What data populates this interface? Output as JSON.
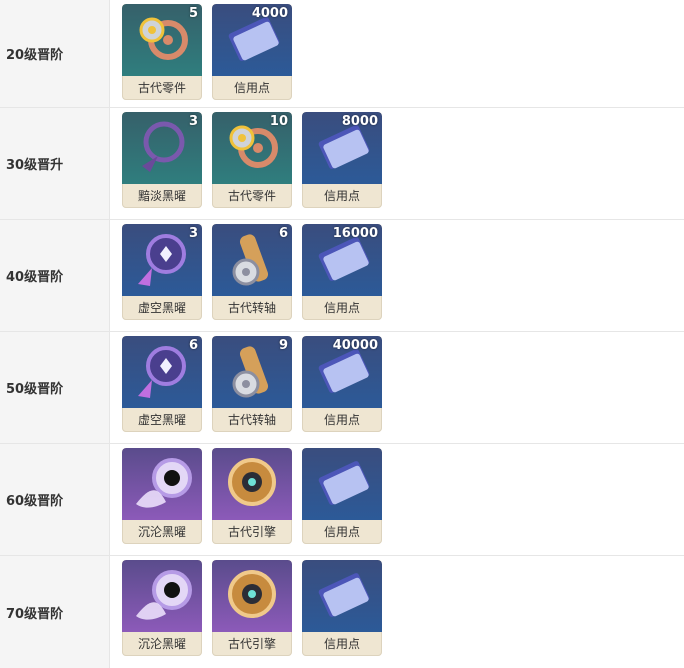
{
  "rows": [
    {
      "label": "20级晋阶",
      "items": [
        {
          "name": "古代零件",
          "count": "5",
          "icon": "ancient-part-icon",
          "bg": "teal"
        },
        {
          "name": "信用点",
          "count": "4000",
          "icon": "credit-icon",
          "bg": "blue"
        }
      ]
    },
    {
      "label": "30级晋升",
      "items": [
        {
          "name": "黯淡黑曜",
          "count": "3",
          "icon": "dim-obsidian-icon",
          "bg": "teal"
        },
        {
          "name": "古代零件",
          "count": "10",
          "icon": "ancient-part-icon",
          "bg": "teal"
        },
        {
          "name": "信用点",
          "count": "8000",
          "icon": "credit-icon",
          "bg": "blue"
        }
      ]
    },
    {
      "label": "40级晋阶",
      "items": [
        {
          "name": "虚空黑曜",
          "count": "3",
          "icon": "void-obsidian-icon",
          "bg": "blue"
        },
        {
          "name": "古代转轴",
          "count": "6",
          "icon": "ancient-spindle-icon",
          "bg": "blue"
        },
        {
          "name": "信用点",
          "count": "16000",
          "icon": "credit-icon",
          "bg": "blue"
        }
      ]
    },
    {
      "label": "50级晋阶",
      "items": [
        {
          "name": "虚空黑曜",
          "count": "6",
          "icon": "void-obsidian-icon",
          "bg": "blue"
        },
        {
          "name": "古代转轴",
          "count": "9",
          "icon": "ancient-spindle-icon",
          "bg": "blue"
        },
        {
          "name": "信用点",
          "count": "40000",
          "icon": "credit-icon",
          "bg": "blue"
        }
      ]
    },
    {
      "label": "60级晋阶",
      "items": [
        {
          "name": "沉沦黑曜",
          "count": "",
          "icon": "sunken-obsidian-icon",
          "bg": "purple"
        },
        {
          "name": "古代引擎",
          "count": "",
          "icon": "ancient-engine-icon",
          "bg": "purple"
        },
        {
          "name": "信用点",
          "count": "",
          "icon": "credit-icon",
          "bg": "blue"
        }
      ]
    },
    {
      "label": "70级晋阶",
      "items": [
        {
          "name": "沉沦黑曜",
          "count": "",
          "icon": "sunken-obsidian-icon",
          "bg": "purple"
        },
        {
          "name": "古代引擎",
          "count": "",
          "icon": "ancient-engine-icon",
          "bg": "purple"
        },
        {
          "name": "信用点",
          "count": "",
          "icon": "credit-icon",
          "bg": "blue"
        }
      ]
    }
  ]
}
